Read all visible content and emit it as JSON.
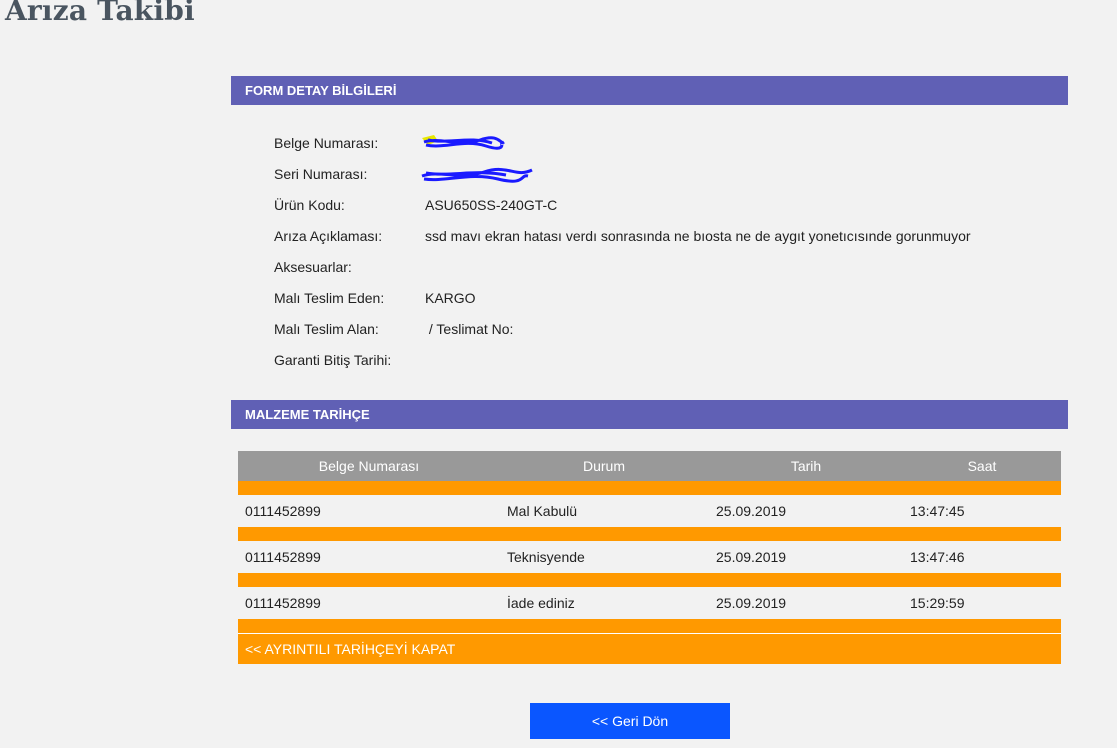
{
  "page": {
    "title": "Arıza Takibi"
  },
  "form_detail": {
    "header": "FORM DETAY BİLGİLERİ",
    "fields": [
      {
        "label": "Belge Numarası:",
        "value": ""
      },
      {
        "label": "Seri Numarası:",
        "value": ""
      },
      {
        "label": "Ürün Kodu:",
        "value": "ASU650SS-240GT-C"
      },
      {
        "label": "Arıza Açıklaması:",
        "value": "ssd mavı ekran hatası verdı sonrasında ne bıosta ne de aygıt yonetıcısınde gorunmuyor"
      },
      {
        "label": "Aksesuarlar:",
        "value": ""
      },
      {
        "label": "Malı Teslim Eden:",
        "value": "KARGO"
      },
      {
        "label": "Malı Teslim Alan:",
        "value": " / Teslimat No:"
      },
      {
        "label": "Garanti Bitiş Tarihi:",
        "value": ""
      }
    ],
    "redaction_color": "#1a1aff",
    "highlight_color": "#e8e800"
  },
  "history": {
    "header": "MALZEME TARİHÇE",
    "columns": [
      "Belge Numarası",
      "Durum",
      "Tarih",
      "Saat"
    ],
    "rows": [
      {
        "belge": "0111452899",
        "durum": "Mal Kabulü",
        "tarih": "25.09.2019",
        "saat": "13:47:45"
      },
      {
        "belge": "0111452899",
        "durum": "Teknisyende",
        "tarih": "25.09.2019",
        "saat": "13:47:46"
      },
      {
        "belge": "0111452899",
        "durum": "İade ediniz",
        "tarih": "25.09.2019",
        "saat": "15:29:59"
      }
    ],
    "collapse_label": "<< AYRINTILI TARİHÇEYİ KAPAT"
  },
  "actions": {
    "back_label": "<< Geri Dön"
  },
  "colors": {
    "panel_header": "#6060b5",
    "table_header": "#999999",
    "accent_orange": "#ff9900",
    "button_blue": "#0a56ff",
    "background": "#f2f2f2"
  }
}
